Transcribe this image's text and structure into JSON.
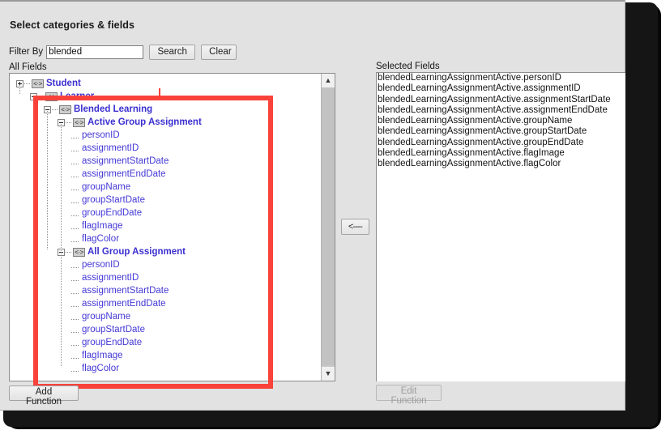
{
  "dialog": {
    "title": "Select categories & fields"
  },
  "filter": {
    "label": "Filter By",
    "value": "blended",
    "placeholder": "",
    "search_label": "Search",
    "clear_label": "Clear"
  },
  "panels": {
    "all_fields_label": "All Fields",
    "selected_fields_label": "Selected Fields"
  },
  "transfer": {
    "remove_label": "<----"
  },
  "tree": [
    {
      "type": "category",
      "label": "Student",
      "depth": 0,
      "toggle": "plus"
    },
    {
      "type": "category",
      "label": "Learner",
      "depth": 1,
      "toggle": "minus"
    },
    {
      "type": "category",
      "label": "Blended Learning",
      "depth": 2,
      "toggle": "minus"
    },
    {
      "type": "category",
      "label": "Active Group Assignment",
      "depth": 3,
      "toggle": "minus"
    },
    {
      "type": "leaf",
      "label": "personID",
      "depth": 4
    },
    {
      "type": "leaf",
      "label": "assignmentID",
      "depth": 4
    },
    {
      "type": "leaf",
      "label": "assignmentStartDate",
      "depth": 4
    },
    {
      "type": "leaf",
      "label": "assignmentEndDate",
      "depth": 4
    },
    {
      "type": "leaf",
      "label": "groupName",
      "depth": 4
    },
    {
      "type": "leaf",
      "label": "groupStartDate",
      "depth": 4
    },
    {
      "type": "leaf",
      "label": "groupEndDate",
      "depth": 4
    },
    {
      "type": "leaf",
      "label": "flagImage",
      "depth": 4
    },
    {
      "type": "leaf",
      "label": "flagColor",
      "depth": 4
    },
    {
      "type": "category",
      "label": "All Group Assignment",
      "depth": 3,
      "toggle": "minus"
    },
    {
      "type": "leaf",
      "label": "personID",
      "depth": 4
    },
    {
      "type": "leaf",
      "label": "assignmentID",
      "depth": 4
    },
    {
      "type": "leaf",
      "label": "assignmentStartDate",
      "depth": 4
    },
    {
      "type": "leaf",
      "label": "assignmentEndDate",
      "depth": 4
    },
    {
      "type": "leaf",
      "label": "groupName",
      "depth": 4
    },
    {
      "type": "leaf",
      "label": "groupStartDate",
      "depth": 4
    },
    {
      "type": "leaf",
      "label": "groupEndDate",
      "depth": 4
    },
    {
      "type": "leaf",
      "label": "flagImage",
      "depth": 4
    },
    {
      "type": "leaf",
      "label": "flagColor",
      "depth": 4
    }
  ],
  "selected_fields": [
    "blendedLearningAssignmentActive.personID",
    "blendedLearningAssignmentActive.assignmentID",
    "blendedLearningAssignmentActive.assignmentStartDate",
    "blendedLearningAssignmentActive.assignmentEndDate",
    "blendedLearningAssignmentActive.groupName",
    "blendedLearningAssignmentActive.groupStartDate",
    "blendedLearningAssignmentActive.groupEndDate",
    "blendedLearningAssignmentActive.flagImage",
    "blendedLearningAssignmentActive.flagColor"
  ],
  "footer": {
    "add_function_label": "Add Function",
    "edit_function_label": "Edit Function"
  },
  "scrollbar": {
    "up_icon": "chevron-up-icon",
    "down_icon": "chevron-down-icon"
  },
  "annotation": {
    "highlight_color": "#f9423a"
  },
  "icons": {
    "category_icon": "<·>"
  }
}
